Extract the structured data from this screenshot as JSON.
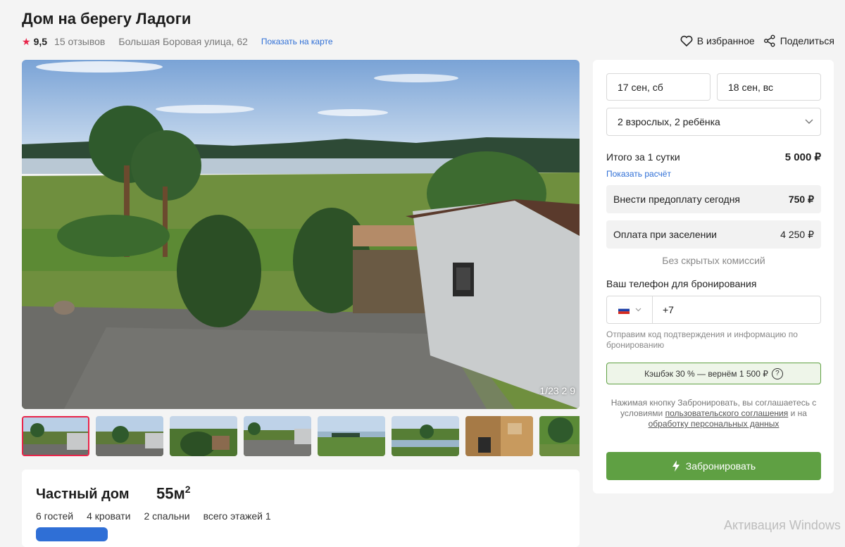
{
  "header": {
    "title": "Дом на берегу Ладоги",
    "rating": "9,5",
    "reviews": "15 отзывов",
    "address": "Большая Боровая улица, 62",
    "map_link": "Показать на карте",
    "favorite_label": "В избранное",
    "share_label": "Поделиться"
  },
  "gallery": {
    "counter": "1/23",
    "counter_tail": "2 9"
  },
  "listing": {
    "kind": "Частный дом",
    "area": "55м",
    "area_sup": "2",
    "facts": [
      "6 гостей",
      "4 кровати",
      "2 спальни",
      "всего этажей 1"
    ]
  },
  "booking": {
    "checkin": "17 сен, сб",
    "checkout": "18 сен, вс",
    "guests": "2 взрослых, 2 ребёнка",
    "total_label": "Итого за 1 сутки",
    "total_value": "5 000 ₽",
    "calc_link": "Показать расчёт",
    "prepay_label": "Внести предоплату сегодня",
    "prepay_value": "750 ₽",
    "checkin_pay_label": "Оплата при заселении",
    "checkin_pay_value": "4 250 ₽",
    "no_fees": "Без скрытых комиссий",
    "phone_label": "Ваш телефон для бронирования",
    "phone_prefix": "+7",
    "phone_hint": "Отправим код подтверждения и информацию по бронированию",
    "cashback": "Кэшбэк 30 % —  вернём 1 500 ₽",
    "terms_pre": "Нажимая кнопку Забронировать, вы соглашаетесь с условиями",
    "terms_link1": "пользовательского соглашения",
    "terms_mid": "и на",
    "terms_link2": "обработку персональных данных",
    "book_button": "Забронировать"
  },
  "os_watermark": "Активация Windows",
  "colors": {
    "accent_green": "#5fa043",
    "rating_red": "#e8254a",
    "link_blue": "#2f6fd6"
  },
  "icons": [
    "star-icon",
    "heart-icon",
    "share-icon",
    "chevron-down-icon",
    "russia-flag-icon",
    "question-icon",
    "lightning-icon"
  ]
}
